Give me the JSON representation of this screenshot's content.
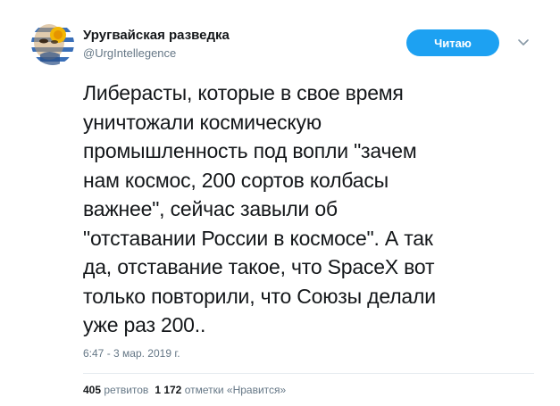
{
  "author": {
    "display_name": "Уругвайская разведка",
    "handle": "@UrgIntellegence",
    "avatar_icon": "uruguay-flag-face-avatar"
  },
  "follow_button": {
    "label": "Читаю",
    "color": "#1da1f2"
  },
  "menu_icon": "chevron-down-icon",
  "tweet": {
    "text": "Либерасты, которые в свое время\nуничтожали космическую\nпромышленность под вопли \"зачем\nнам космос, 200 сортов колбасы\nважнее\", сейчас завыли об\n\"отставании России в космосе\". А так\nда, отставание такое, что SpaceX вот\nтолько повторили, что Союзы делали\nуже раз 200..",
    "timestamp": "6:47 - 3 мар. 2019 г."
  },
  "stats": {
    "retweets_count": "405",
    "retweets_label": "ретвитов",
    "likes_count": "1 172",
    "likes_label": "отметки «Нравится»"
  }
}
